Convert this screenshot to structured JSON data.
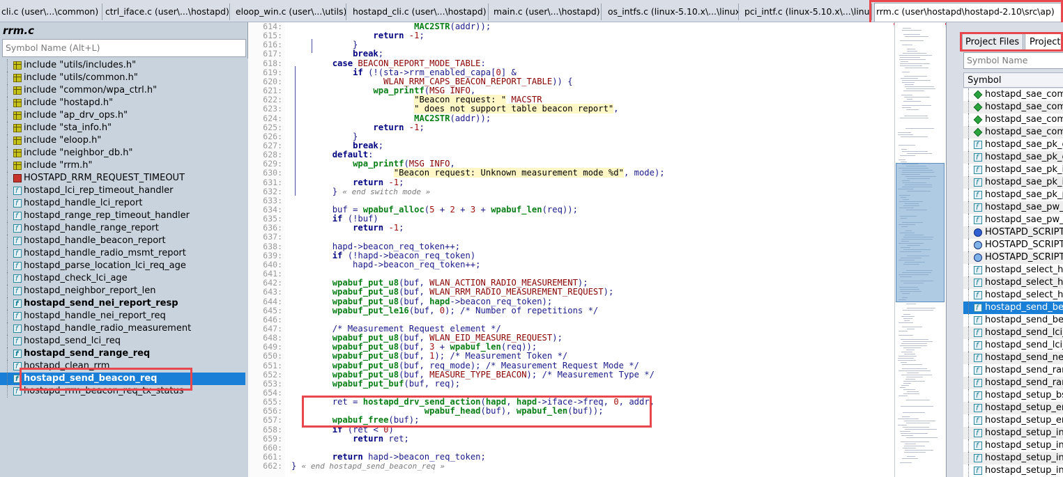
{
  "tabs": [
    {
      "label": "cli.c (user\\...\\common)",
      "active": false
    },
    {
      "label": "ctrl_iface.c (user\\...\\hostapd)",
      "active": false
    },
    {
      "label": "eloop_win.c (user\\...\\utils)",
      "active": false
    },
    {
      "label": "hostapd_cli.c (user\\...\\hostapd)",
      "active": false
    },
    {
      "label": "main.c (user\\...\\hostapd)",
      "active": false
    },
    {
      "label": "os_intfs.c (linux-5.10.x\\...\\linux)",
      "active": false
    },
    {
      "label": "pci_intf.c (linux-5.10.x\\...\\linux)",
      "active": false
    },
    {
      "label": "rrm.c (user\\hostapd\\hostapd-2.10\\src\\ap)",
      "active": true
    }
  ],
  "symbol_panel": {
    "title": "rrm.c",
    "search_placeholder": "Symbol Name (Alt+L)",
    "items": [
      {
        "label": "include \"utils/includes.h\"",
        "icon": "include-icon"
      },
      {
        "label": "include \"utils/common.h\"",
        "icon": "include-icon"
      },
      {
        "label": "include \"common/wpa_ctrl.h\"",
        "icon": "include-icon"
      },
      {
        "label": "include \"hostapd.h\"",
        "icon": "include-icon"
      },
      {
        "label": "include \"ap_drv_ops.h\"",
        "icon": "include-icon"
      },
      {
        "label": "include \"sta_info.h\"",
        "icon": "include-icon"
      },
      {
        "label": "include \"eloop.h\"",
        "icon": "include-icon"
      },
      {
        "label": "include \"neighbor_db.h\"",
        "icon": "include-icon"
      },
      {
        "label": "include \"rrm.h\"",
        "icon": "include-icon"
      },
      {
        "label": "HOSTAPD_RRM_REQUEST_TIMEOUT",
        "icon": "define-icon"
      },
      {
        "label": "hostapd_lci_rep_timeout_handler",
        "icon": "function-icon"
      },
      {
        "label": "hostapd_handle_lci_report",
        "icon": "function-icon"
      },
      {
        "label": "hostapd_range_rep_timeout_handler",
        "icon": "function-icon"
      },
      {
        "label": "hostapd_handle_range_report",
        "icon": "function-icon"
      },
      {
        "label": "hostapd_handle_beacon_report",
        "icon": "function-icon"
      },
      {
        "label": "hostapd_handle_radio_msmt_report",
        "icon": "function-icon"
      },
      {
        "label": "hostapd_parse_location_lci_req_age",
        "icon": "function-icon"
      },
      {
        "label": "hostapd_check_lci_age",
        "icon": "function-icon"
      },
      {
        "label": "hostapd_neighbor_report_len",
        "icon": "function-icon"
      },
      {
        "label": "hostapd_send_nei_report_resp",
        "icon": "function-icon",
        "bold": true
      },
      {
        "label": "hostapd_handle_nei_report_req",
        "icon": "function-icon"
      },
      {
        "label": "hostapd_handle_radio_measurement",
        "icon": "function-icon"
      },
      {
        "label": "hostapd_send_lci_req",
        "icon": "function-icon"
      },
      {
        "label": "hostapd_send_range_req",
        "icon": "function-icon",
        "bold": true
      },
      {
        "label": "hostapd_clean_rrm",
        "icon": "function-icon"
      },
      {
        "label": "hostapd_send_beacon_req",
        "icon": "function-icon",
        "bold": true,
        "selected": true
      },
      {
        "label": "hostapd_rrm_beacon_req_tx_status",
        "icon": "function-icon"
      }
    ]
  },
  "editor": {
    "lines": [
      {
        "n": "614:",
        "html": "                        <span class=\"fn\">MAC2STR</span>(addr));"
      },
      {
        "n": "615:",
        "html": "                <span class=\"kw\">return</span> <span class=\"num\">-1</span>;"
      },
      {
        "n": "616:",
        "html": "            }"
      },
      {
        "n": "617:",
        "html": "            <span class=\"kw\">break</span>;"
      },
      {
        "n": "618:",
        "html": "        <span class=\"kw\">case</span> <span class=\"mac\">BEACON_REPORT_MODE_TABLE</span>:"
      },
      {
        "n": "619:",
        "html": "            <span class=\"kw\">if</span> (!(sta-&gt;rrm_enabled_capa[<span class=\"num\">0</span>] &amp;"
      },
      {
        "n": "620:",
        "html": "                  <span class=\"mac\">WLAN_RRM_CAPS_BEACON_REPORT_TABLE</span>)) {"
      },
      {
        "n": "621:",
        "html": "                <span class=\"fn\">wpa_printf</span>(<span class=\"mac\">MSG_INFO</span>,"
      },
      {
        "n": "622:",
        "html": "                        <span class=\"str\">\"Beacon request: \"</span> <span class=\"mac\">MACSTR</span>"
      },
      {
        "n": "623:",
        "html": "                        <span class=\"str\">\" does not support table beacon report\"</span>,"
      },
      {
        "n": "624:",
        "html": "                        <span class=\"fn\">MAC2STR</span>(addr));"
      },
      {
        "n": "625:",
        "html": "                <span class=\"kw\">return</span> <span class=\"num\">-1</span>;"
      },
      {
        "n": "626:",
        "html": "            }"
      },
      {
        "n": "627:",
        "html": "            <span class=\"kw\">break</span>;"
      },
      {
        "n": "628:",
        "html": "        <span class=\"kw\">default</span>:"
      },
      {
        "n": "629:",
        "html": "            <span class=\"fn\">wpa_printf</span>(<span class=\"mac\">MSG_INFO</span>,"
      },
      {
        "n": "630:",
        "html": "                    <span class=\"str\">\"Beacon request: Unknown measurement mode %d\"</span>, mode);"
      },
      {
        "n": "631:",
        "html": "            <span class=\"kw\">return</span> <span class=\"num\">-1</span>;"
      },
      {
        "n": "632:",
        "html": "        } <span class=\"fold\">« end switch mode »</span>"
      },
      {
        "n": "633:",
        "html": ""
      },
      {
        "n": "634:",
        "html": "        buf = <span class=\"fn\">wpabuf_alloc</span>(<span class=\"num\">5</span> + <span class=\"num\">2</span> + <span class=\"num\">3</span> + <span class=\"fn\">wpabuf_len</span>(req));"
      },
      {
        "n": "635:",
        "html": "        <span class=\"kw\">if</span> (!buf)"
      },
      {
        "n": "636:",
        "html": "            <span class=\"kw\">return</span> <span class=\"num\">-1</span>;"
      },
      {
        "n": "637:",
        "html": ""
      },
      {
        "n": "638:",
        "html": "        hapd-&gt;beacon_req_token++;"
      },
      {
        "n": "639:",
        "html": "        <span class=\"kw\">if</span> (!hapd-&gt;beacon_req_token)"
      },
      {
        "n": "640:",
        "html": "            hapd-&gt;beacon_req_token++;"
      },
      {
        "n": "641:",
        "html": ""
      },
      {
        "n": "642:",
        "html": "        <span class=\"fn\">wpabuf_put_u8</span>(buf, <span class=\"mac\">WLAN_ACTION_RADIO_MEASUREMENT</span>);"
      },
      {
        "n": "643:",
        "html": "        <span class=\"fn\">wpabuf_put_u8</span>(buf, <span class=\"mac\">WLAN_RRM_RADIO_MEASUREMENT_REQUEST</span>);"
      },
      {
        "n": "644:",
        "html": "        <span class=\"fn\">wpabuf_put_u8</span>(buf, <span class=\"fn\">hapd</span>-&gt;beacon_req_token);"
      },
      {
        "n": "645:",
        "html": "        <span class=\"fn\">wpabuf_put_le16</span>(buf, <span class=\"num\">0</span>); <span class=\"cm\">/* Number of repetitions */</span>"
      },
      {
        "n": "646:",
        "html": ""
      },
      {
        "n": "647:",
        "html": "        <span class=\"cm\">/* Measurement Request element */</span>"
      },
      {
        "n": "648:",
        "html": "        <span class=\"fn\">wpabuf_put_u8</span>(buf, <span class=\"mac\">WLAN_EID_MEASURE_REQUEST</span>);"
      },
      {
        "n": "649:",
        "html": "        <span class=\"fn\">wpabuf_put_u8</span>(buf, <span class=\"num\">3</span> + <span class=\"fn\">wpabuf_len</span>(req));"
      },
      {
        "n": "650:",
        "html": "        <span class=\"fn\">wpabuf_put_u8</span>(buf, <span class=\"num\">1</span>); <span class=\"cm\">/* Measurement Token */</span>"
      },
      {
        "n": "651:",
        "html": "        <span class=\"fn\">wpabuf_put_u8</span>(buf, req_mode); <span class=\"cm\">/* Measurement Request Mode */</span>"
      },
      {
        "n": "652:",
        "html": "        <span class=\"fn\">wpabuf_put_u8</span>(buf, <span class=\"mac\">MEASURE_TYPE_BEACON</span>); <span class=\"cm\">/* Measurement Type */</span>"
      },
      {
        "n": "653:",
        "html": "        <span class=\"fn\">wpabuf_put_buf</span>(buf, req);"
      },
      {
        "n": "654:",
        "html": ""
      },
      {
        "n": "655:",
        "html": "        ret = <span class=\"fn\">hostapd_drv_send_action</span>(<span class=\"fn\">hapd</span>, <span class=\"fn\">hapd</span>-&gt;iface-&gt;freq, <span class=\"num\">0</span>, addr,"
      },
      {
        "n": "656:",
        "html": "                          <span class=\"fn\">wpabuf_head</span>(buf), <span class=\"fn\">wpabuf_len</span>(buf));"
      },
      {
        "n": "657:",
        "html": "        <span class=\"fn\">wpabuf_free</span>(buf);"
      },
      {
        "n": "658:",
        "html": "        <span class=\"kw\">if</span> (ret &lt; <span class=\"num\">0</span>)"
      },
      {
        "n": "659:",
        "html": "            <span class=\"kw\">return</span> ret;"
      },
      {
        "n": "660:",
        "html": ""
      },
      {
        "n": "661:",
        "html": "        <span class=\"kw\">return</span> hapd-&gt;beacon_req_token;"
      },
      {
        "n": "662:",
        "html": "} <span class=\"fold\">« end hostapd_send_beacon_req »</span>"
      }
    ]
  },
  "project_panel": {
    "tab_project_files": "Project Files",
    "tab_project_symbols": "Project S",
    "search_placeholder": "Symbol Name",
    "column_header": "Symbol",
    "items": [
      {
        "label": "hostapd_sae_comm",
        "icon": "diamond-icon"
      },
      {
        "label": "hostapd_sae_comm",
        "icon": "diamond-icon"
      },
      {
        "label": "hostapd_sae_comm",
        "icon": "diamond-icon"
      },
      {
        "label": "hostapd_sae_comm",
        "icon": "diamond-icon"
      },
      {
        "label": "hostapd_sae_pk_ex",
        "icon": "function-icon"
      },
      {
        "label": "hostapd_sae_pk_ex",
        "icon": "function-icon"
      },
      {
        "label": "hostapd_sae_pk_in_",
        "icon": "function-icon"
      },
      {
        "label": "hostapd_sae_pk_in_",
        "icon": "function-icon"
      },
      {
        "label": "hostapd_sae_pk_pa",
        "icon": "function-icon"
      },
      {
        "label": "hostapd_sae_pw_id",
        "icon": "function-icon"
      },
      {
        "label": "hostapd_sae_pw_id",
        "icon": "function-icon"
      },
      {
        "label": "HOSTAPD_SCRIPT_N",
        "icon": "circle-icon"
      },
      {
        "label": "HOSTAPD_SCRIPT_N",
        "icon": "circle-icon-light"
      },
      {
        "label": "HOSTAPD_SCRIPT_N",
        "icon": "circle-icon-light"
      },
      {
        "label": "hostapd_select_hw_",
        "icon": "function-icon"
      },
      {
        "label": "hostapd_select_hw_",
        "icon": "function-icon"
      },
      {
        "label": "hostapd_select_hw_",
        "icon": "function-icon"
      },
      {
        "label": "hostapd_send_beac",
        "icon": "function-icon",
        "selected": true
      },
      {
        "label": "hostapd_send_beac",
        "icon": "function-icon"
      },
      {
        "label": "hostapd_send_lci_re",
        "icon": "function-icon"
      },
      {
        "label": "hostapd_send_lci_re",
        "icon": "function-icon"
      },
      {
        "label": "hostapd_send_nei_r",
        "icon": "function-icon"
      },
      {
        "label": "hostapd_send_rang",
        "icon": "function-icon"
      },
      {
        "label": "hostapd_send_rang",
        "icon": "function-icon"
      },
      {
        "label": "hostapd_setup_bss",
        "icon": "function-icon"
      },
      {
        "label": "hostapd_setup_encr",
        "icon": "function-icon"
      },
      {
        "label": "hostapd_setup_encr",
        "icon": "function-icon"
      },
      {
        "label": "hostapd_setup_inte",
        "icon": "function-icon"
      },
      {
        "label": "hostapd_setup_inte",
        "icon": "function-icon"
      },
      {
        "label": "hostapd_setup_inte",
        "icon": "function-icon"
      },
      {
        "label": "hostapd_setup_inte",
        "icon": "function-icon"
      }
    ]
  },
  "colors": {
    "highlight_box": "#e8484d",
    "selection": "#1a7fd6",
    "keyword": "#000080",
    "function": "#087f16",
    "macro": "#8b0000"
  }
}
